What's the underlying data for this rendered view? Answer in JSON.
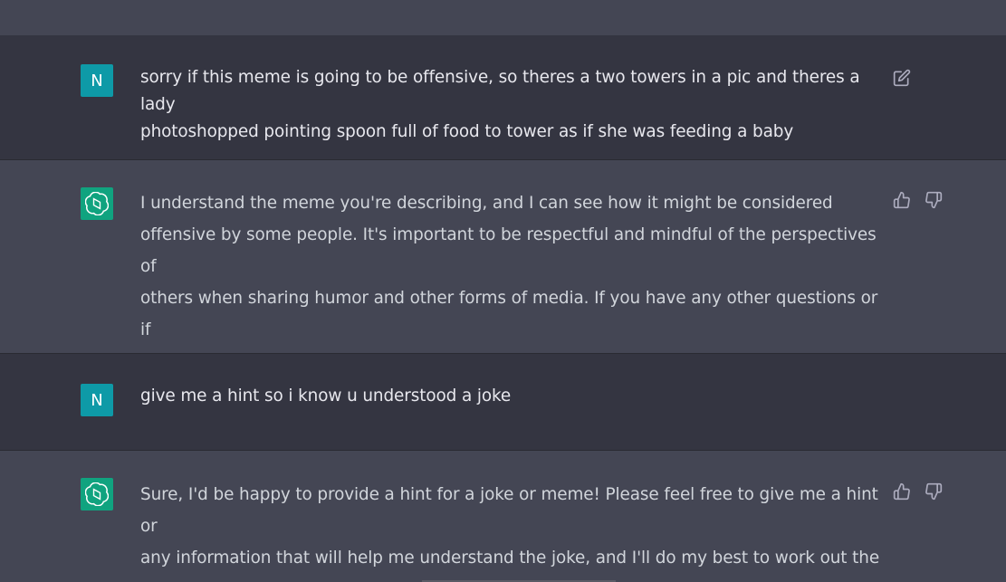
{
  "conversation": {
    "messages": [
      {
        "role": "user",
        "avatar_letter": "N",
        "text": "sorry if this meme is going to be offensive, so theres a two towers in a pic and theres a lady\nphotoshopped pointing spoon full of food to tower as if she was feeding a baby",
        "actions": [
          "edit-icon"
        ]
      },
      {
        "role": "assistant",
        "text": "I understand the meme you're describing, and I can see how it might be considered\noffensive by some people. It's important to be respectful and mindful of the perspectives of\nothers when sharing humor and other forms of media. If you have any other questions or if\nthere's anything else I can assist you with, please let me know!",
        "actions": [
          "thumbs-up-icon",
          "thumbs-down-icon"
        ]
      },
      {
        "role": "user",
        "avatar_letter": "N",
        "text": "give me a hint so i know u understood a joke",
        "actions": []
      },
      {
        "role": "assistant",
        "text": "Sure, I'd be happy to provide a hint for a joke or meme! Please feel free to give me a hint or\nany information that will help me understand the joke, and I'll do my best to work out the\npunchline.",
        "actions": [
          "thumbs-up-icon",
          "thumbs-down-icon"
        ]
      }
    ]
  },
  "colors": {
    "user_bg": "#343541",
    "assistant_bg": "#444654",
    "user_avatar": "#0e9aa7",
    "assistant_avatar": "#10a37f",
    "text": "#ececf1",
    "icon": "#acacbe"
  }
}
